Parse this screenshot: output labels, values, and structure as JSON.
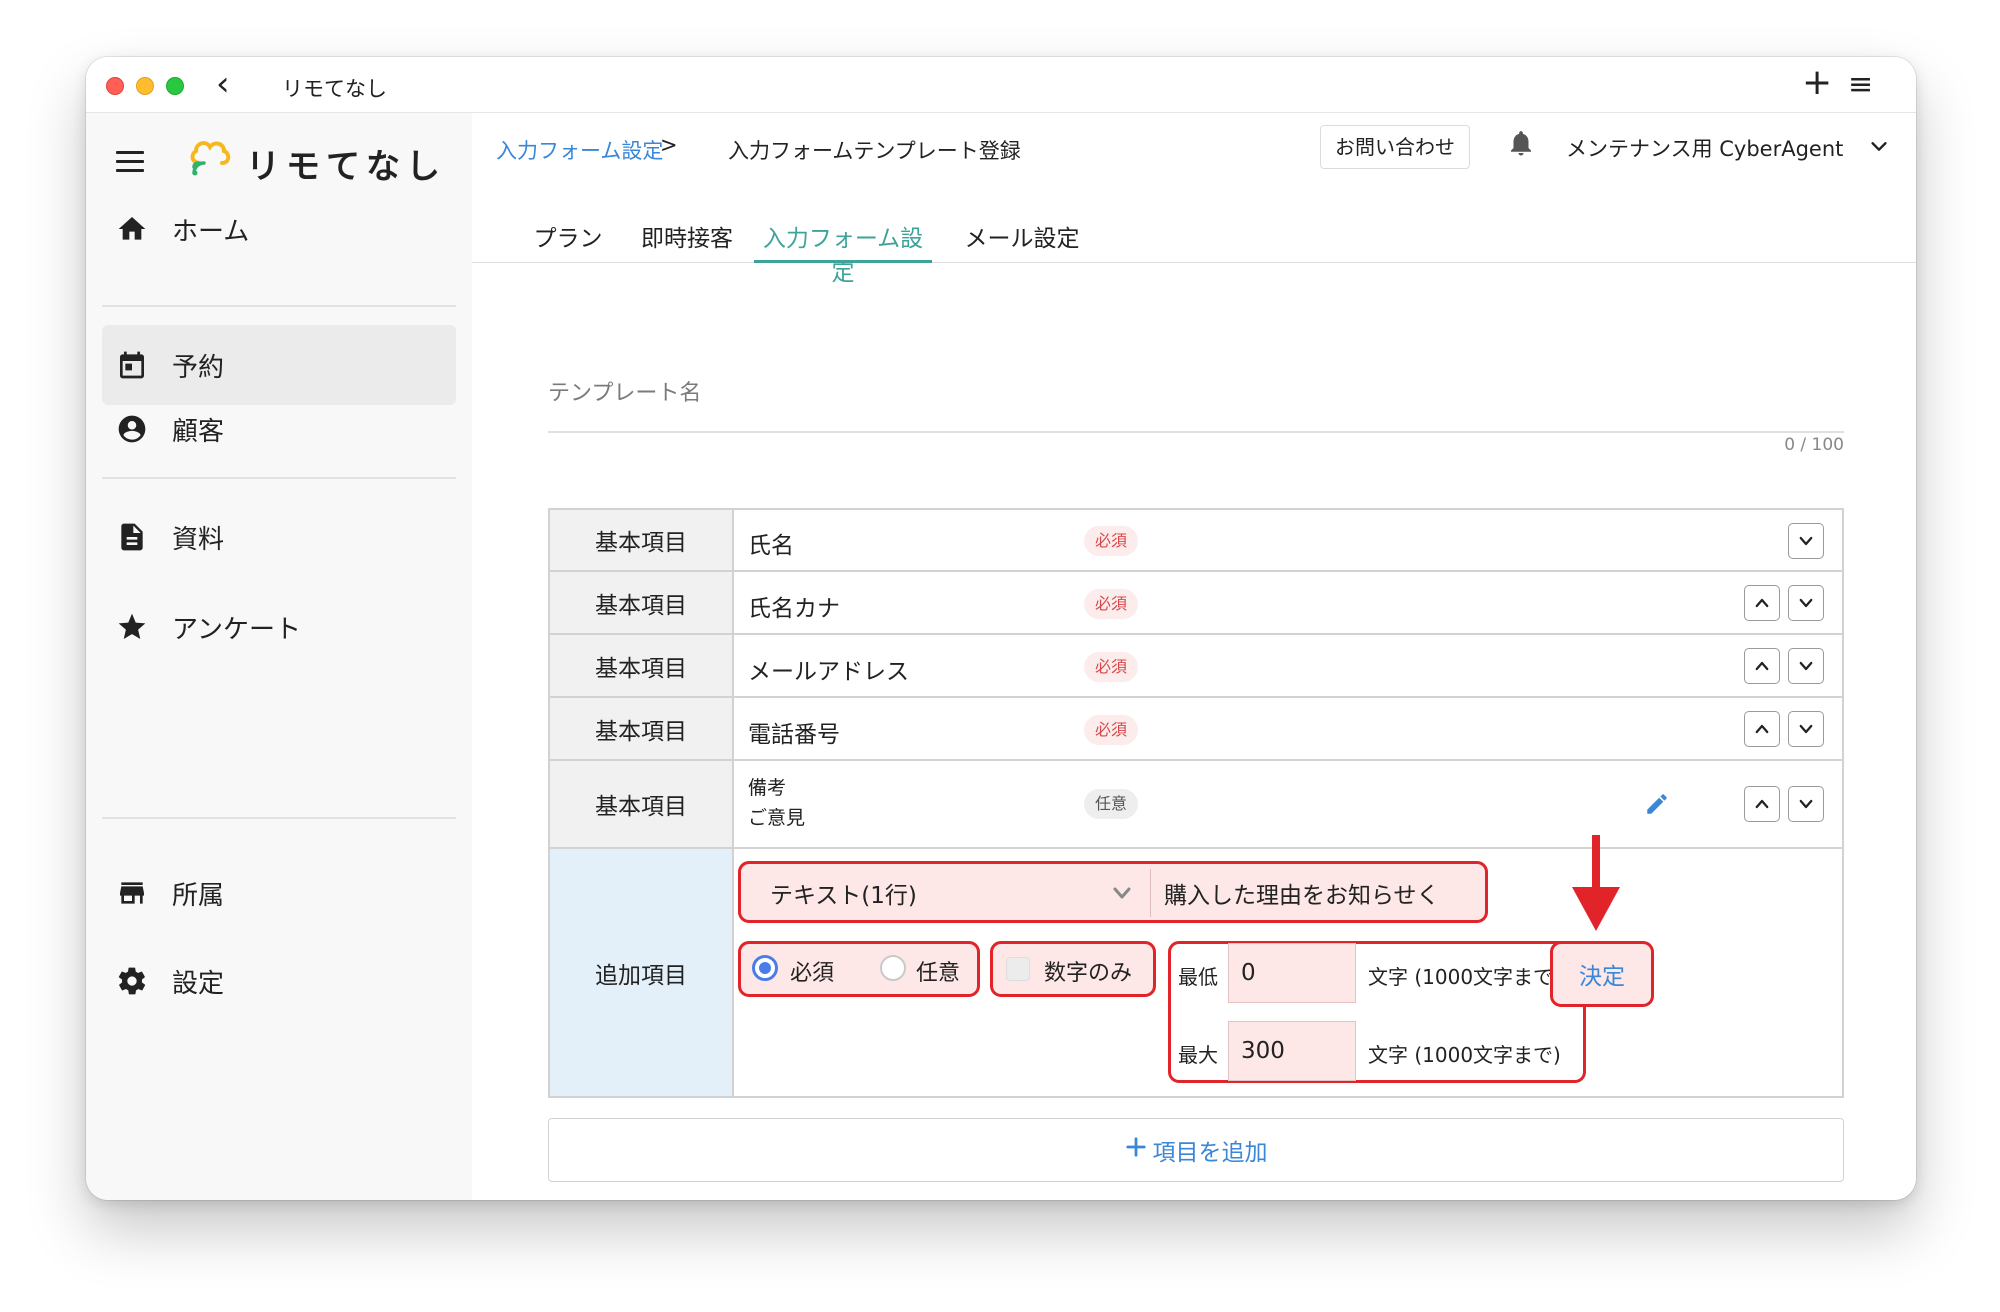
{
  "window": {
    "title": "リモてなし",
    "back_glyph": "‹",
    "plus_glyph": "+",
    "menu_glyph": "≡"
  },
  "sidebar": {
    "logo_text": "リモてなし",
    "items": [
      {
        "label": "ホーム",
        "icon": "home-icon"
      },
      {
        "label": "予約",
        "icon": "calendar-icon",
        "active": true
      },
      {
        "label": "顧客",
        "icon": "account-circle-icon"
      },
      {
        "label": "資料",
        "icon": "document-icon"
      },
      {
        "label": "アンケート",
        "icon": "star-icon"
      },
      {
        "label": "所属",
        "icon": "store-icon"
      },
      {
        "label": "設定",
        "icon": "gear-icon"
      }
    ]
  },
  "header": {
    "breadcrumb": {
      "link": "入力フォーム設定",
      "separator": ">",
      "current": "入力フォームテンプレート登録"
    },
    "contact_label": "お問い合わせ",
    "user_name": "メンテナンス用 CyberAgent"
  },
  "tabs": [
    {
      "label": "プラン"
    },
    {
      "label": "即時接客"
    },
    {
      "label": "入力フォーム設定",
      "active": true
    },
    {
      "label": "メール設定"
    }
  ],
  "template": {
    "name_placeholder": "テンプレート名",
    "counter": "0 / 100"
  },
  "fields": [
    {
      "category": "基本項目",
      "name": "氏名",
      "badge": "必須"
    },
    {
      "category": "基本項目",
      "name": "氏名カナ",
      "badge": "必須"
    },
    {
      "category": "基本項目",
      "name": "メールアドレス",
      "badge": "必須"
    },
    {
      "category": "基本項目",
      "name": "電話番号",
      "badge": "必須"
    },
    {
      "category": "基本項目",
      "name_line1": "備考",
      "name_line2": "ご意見",
      "badge": "任意"
    }
  ],
  "extra": {
    "category": "追加項目",
    "type_value": "テキスト(1行)",
    "title_value": "購入した理由をお知らせく",
    "required_label": "必須",
    "optional_label": "任意",
    "selected": "必須",
    "numeric_only_label": "数字のみ",
    "numeric_only_checked": false,
    "min_label": "最低",
    "min_value": "0",
    "max_label": "最大",
    "max_value": "300",
    "limit_note": "文字 (1000文字まで)",
    "decide_label": "決定"
  },
  "add_item_label": "項目を追加",
  "colors": {
    "accent": "#3ea39a",
    "link": "#3a86d8",
    "highlight": "#e0242a",
    "required": "#d84848"
  }
}
